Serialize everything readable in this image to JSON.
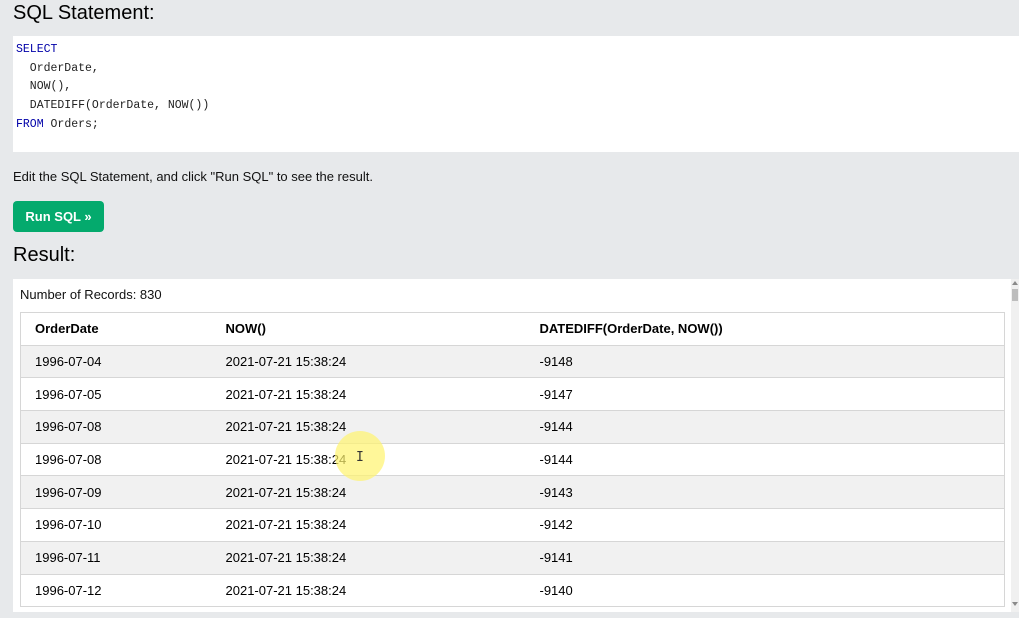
{
  "sql_heading": "SQL Statement:",
  "editor": {
    "lines": [
      {
        "keyword": "SELECT",
        "text": ""
      },
      {
        "keyword": "",
        "text": "  OrderDate,"
      },
      {
        "keyword": "",
        "text": "  NOW(),"
      },
      {
        "keyword": "",
        "text": "  DATEDIFF(OrderDate, NOW())"
      },
      {
        "keyword": "FROM",
        "text": " Orders;"
      }
    ]
  },
  "instruction": "Edit the SQL Statement, and click \"Run SQL\" to see the result.",
  "run_button_label": "Run SQL »",
  "result_heading": "Result:",
  "result": {
    "records_text": "Number of Records: 830",
    "columns": [
      "OrderDate",
      "NOW()",
      "DATEDIFF(OrderDate, NOW())"
    ],
    "rows": [
      [
        "1996-07-04",
        "2021-07-21 15:38:24",
        "-9148"
      ],
      [
        "1996-07-05",
        "2021-07-21 15:38:24",
        "-9147"
      ],
      [
        "1996-07-08",
        "2021-07-21 15:38:24",
        "-9144"
      ],
      [
        "1996-07-08",
        "2021-07-21 15:38:24",
        "-9144"
      ],
      [
        "1996-07-09",
        "2021-07-21 15:38:24",
        "-9143"
      ],
      [
        "1996-07-10",
        "2021-07-21 15:38:24",
        "-9142"
      ],
      [
        "1996-07-11",
        "2021-07-21 15:38:24",
        "-9141"
      ],
      [
        "1996-07-12",
        "2021-07-21 15:38:24",
        "-9140"
      ]
    ]
  },
  "colors": {
    "page_background": "#e7e9eb",
    "run_button": "#04aa6d",
    "sql_keyword": "#0000a8",
    "cursor_highlight": "#fff36e"
  },
  "icons": {
    "cursor": "text-cursor-icon"
  }
}
